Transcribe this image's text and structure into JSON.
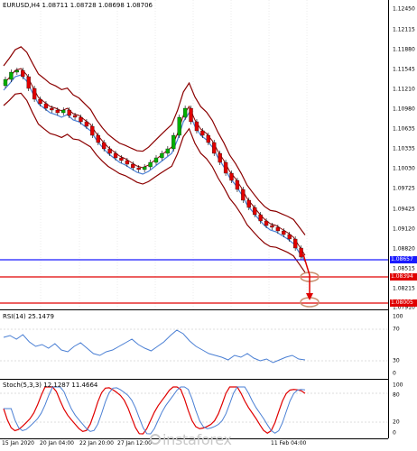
{
  "symbol_header": "EURUSD,H4  1.08711 1.08728 1.08698 1.08706",
  "rsi_header": "RSI(14) 25.1479",
  "stoch_header": "Stoch(5,3,3) 12.1287 11.4664",
  "price_axis": [
    "1.12450",
    "1.12115",
    "1.11880",
    "1.11545",
    "1.11210",
    "1.10980",
    "1.10635",
    "1.10335",
    "1.10030",
    "1.09725",
    "1.09425",
    "1.09120",
    "1.08820",
    "1.08515",
    "1.08215",
    "1.07910"
  ],
  "price_tags": [
    {
      "label": "1.08657",
      "color": "#1a1aff"
    },
    {
      "label": "1.08394",
      "color": "#e00000"
    },
    {
      "label": "1.08005",
      "color": "#e00000"
    }
  ],
  "rsi_levels": [
    "100",
    "70",
    "30",
    "0"
  ],
  "stoch_levels": [
    "100",
    "80",
    "20",
    "0"
  ],
  "time_axis": [
    "15 Jan 2020",
    "20 Jan 04:00",
    "22 Jan 20:00",
    "27 Jan 12:00",
    "11 Feb 04:00"
  ],
  "watermark": "instaforex",
  "colors": {
    "bull": "#00b000",
    "bear": "#e00000",
    "bands": "#8b0000",
    "ma": "#4a7fd4",
    "rsi": "#4a7fd4",
    "stoch_main": "#e00000",
    "stoch_signal": "#4a7fd4",
    "support_blue": "#1a1aff",
    "target_red": "#e00000"
  },
  "icons": [
    "arrow-down-icon",
    "target-circle-icon",
    "instaforex-logo-icon"
  ]
}
